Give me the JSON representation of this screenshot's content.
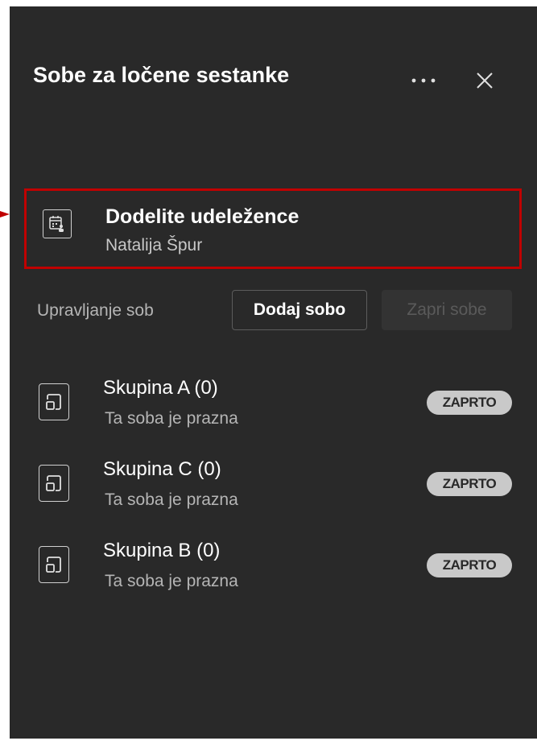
{
  "header": {
    "title": "Sobe za ločene sestanke",
    "more_icon": "more-horizontal-icon",
    "close_icon": "close-icon"
  },
  "assign": {
    "title": "Dodelite udeležence",
    "subtitle": "Natalija Špur",
    "icon": "calendar-people-icon"
  },
  "management": {
    "label": "Upravljanje sob",
    "add_label": "Dodaj sobo",
    "close_label": "Zapri sobe"
  },
  "rooms": [
    {
      "name": "Skupina A (0)",
      "status": "Ta soba je prazna",
      "badge": "ZAPRTO"
    },
    {
      "name": "Skupina C (0)",
      "status": "Ta soba je prazna",
      "badge": "ZAPRTO"
    },
    {
      "name": "Skupina B (0)",
      "status": "Ta soba je prazna",
      "badge": "ZAPRTO"
    }
  ],
  "colors": {
    "panel": "#292929",
    "highlight": "#c00000",
    "badge": "#c9c9c9"
  }
}
